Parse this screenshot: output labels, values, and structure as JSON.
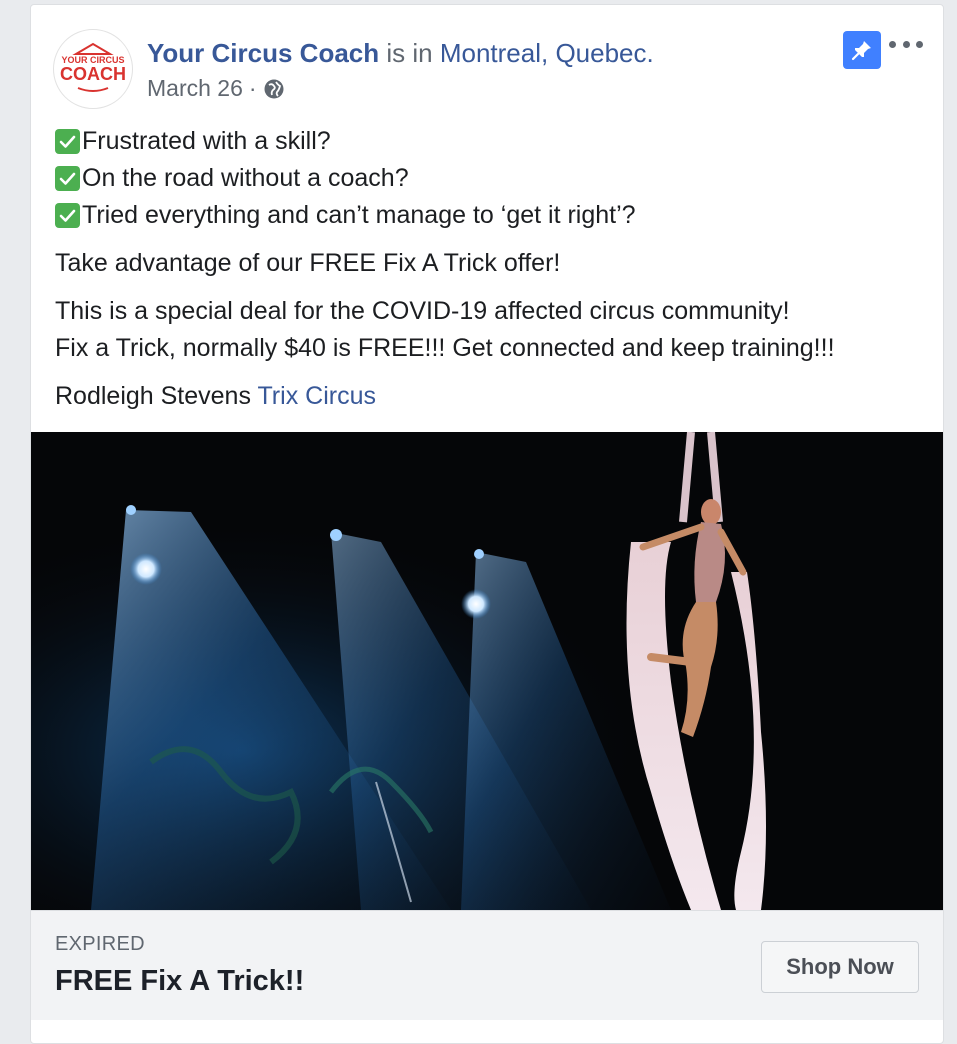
{
  "colors": {
    "link": "#385898",
    "pin_bg": "#4080ff",
    "check_bg": "#4caf50",
    "brand_red": "#d9332f"
  },
  "post": {
    "author": "Your Circus Coach",
    "location_prefix": "is in",
    "location": "Montreal, Quebec.",
    "date": "March 26",
    "separator": "·",
    "privacy_icon": "globe-icon",
    "avatar_logo": "YOUR CIRCUS COACH",
    "checklist": [
      {
        "icon": "check-mark-icon",
        "text": "Frustrated with a skill?"
      },
      {
        "icon": "check-mark-icon",
        "text": "On the road without a coach?"
      },
      {
        "icon": "check-mark-icon",
        "text": "Tried everything and can’t manage to ‘get it right’?"
      }
    ],
    "paragraph_1": "Take advantage of our FREE Fix A Trick offer!",
    "paragraph_2_line_1": "This is a special deal for the COVID-19 affected circus community!",
    "paragraph_2_line_2": "Fix a Trick, normally $40 is FREE!!! Get connected and keep training!!!",
    "tag_person": "Rodleigh Stevens",
    "tag_page": "Trix Circus"
  },
  "offer": {
    "status": "EXPIRED",
    "title": "FREE Fix A Trick!!",
    "button_label": "Shop Now"
  }
}
